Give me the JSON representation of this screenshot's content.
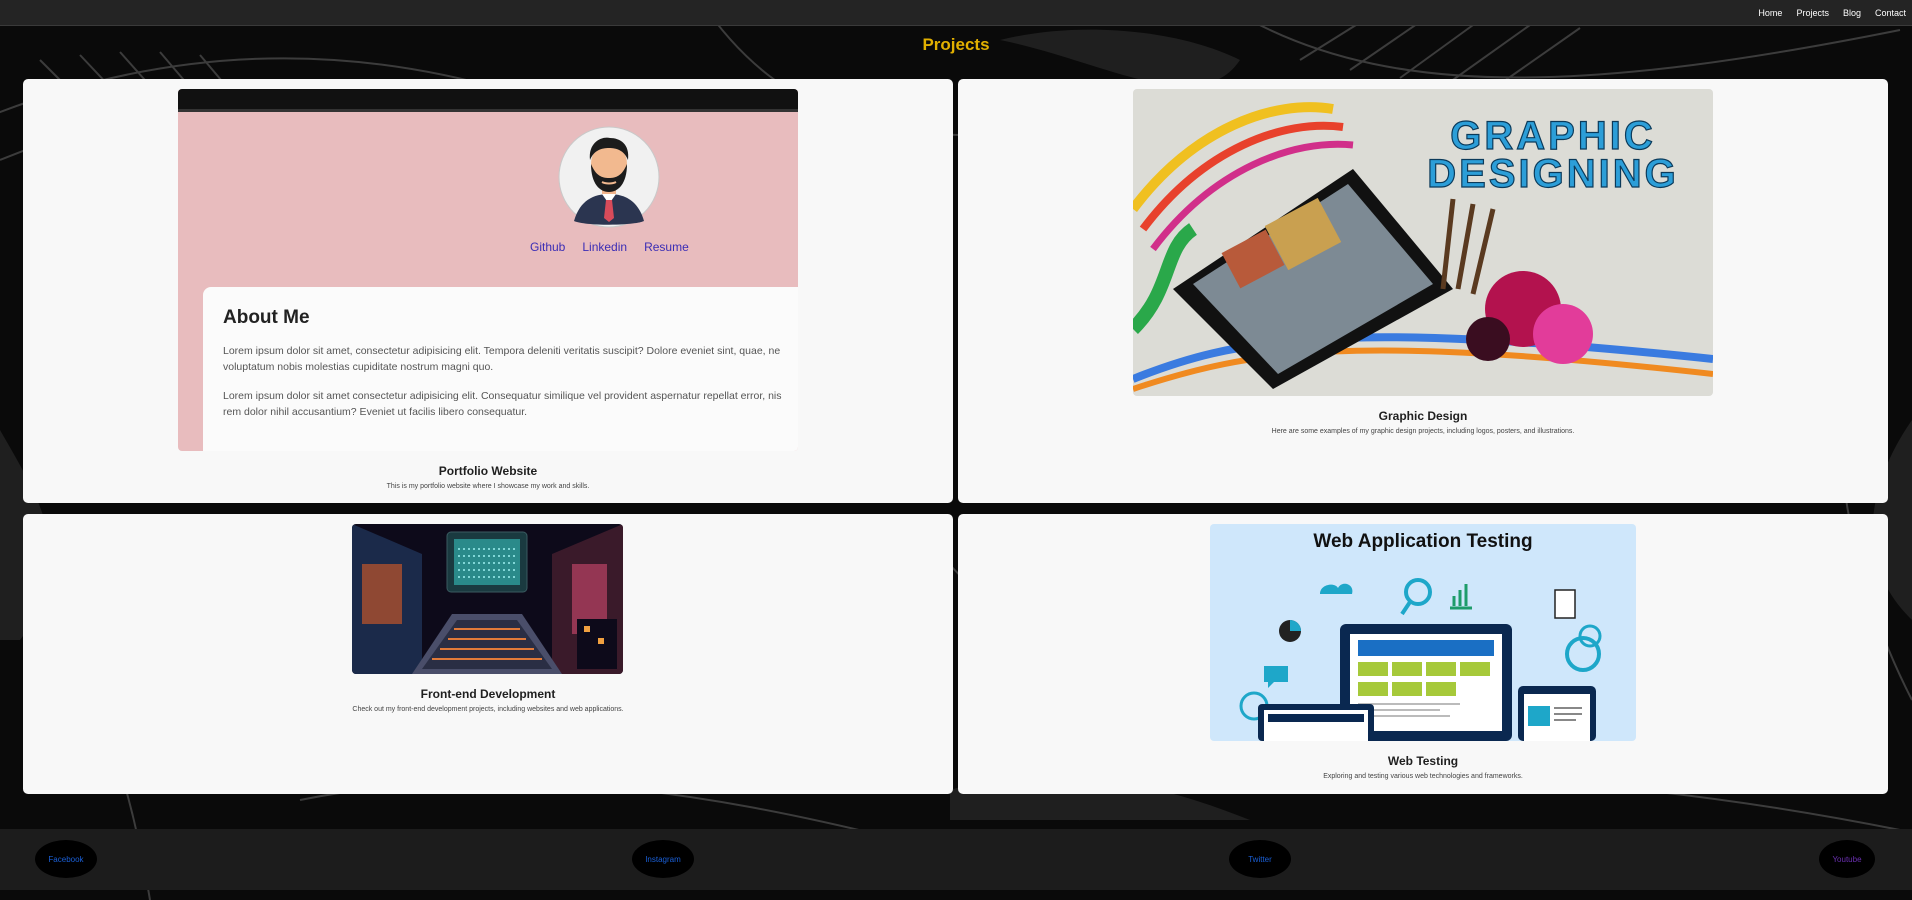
{
  "nav": {
    "links": [
      "Home",
      "Projects",
      "Blog",
      "Contact"
    ]
  },
  "page_title": "Projects",
  "projects": [
    {
      "title": "Portfolio Website",
      "description": "This is my portfolio website where I showcase my work and skills.",
      "preview": {
        "links": [
          "Github",
          "Linkedin",
          "Resume"
        ],
        "about_heading": "About Me",
        "para1_line1": "Lorem ipsum dolor sit amet, consectetur adipisicing elit. Tempora deleniti veritatis suscipit? Dolore eveniet sint, quae, ne",
        "para1_line2": "voluptatum nobis molestias cupiditate nostrum magni quo.",
        "para2_line1": "Lorem ipsum dolor sit amet consectetur adipisicing elit. Consequatur similique vel provident aspernatur repellat error, nis",
        "para2_line2": "rem dolor nihil accusantium? Eveniet ut facilis libero consequatur."
      }
    },
    {
      "title": "Graphic Design",
      "description": "Here are some examples of my graphic design projects, including logos, posters, and illustrations.",
      "banner_line1": "GRAPHIC",
      "banner_line2": "DESIGNING"
    },
    {
      "title": "Front-end Development",
      "description": "Check out my front-end development projects, including websites and web applications."
    },
    {
      "title": "Web Testing",
      "description": "Exploring and testing various web technologies and frameworks.",
      "banner": "Web Application Testing"
    }
  ],
  "social": [
    "Facebook",
    "Instagram",
    "Twitter",
    "Youtube"
  ],
  "colors": {
    "accent": "#e2b000",
    "nav_bg": "#242424",
    "card_bg": "#f8f8f8",
    "link": "#3b2db5",
    "social_link": "#1a5fd6",
    "social_visited": "#6a2fb0"
  }
}
